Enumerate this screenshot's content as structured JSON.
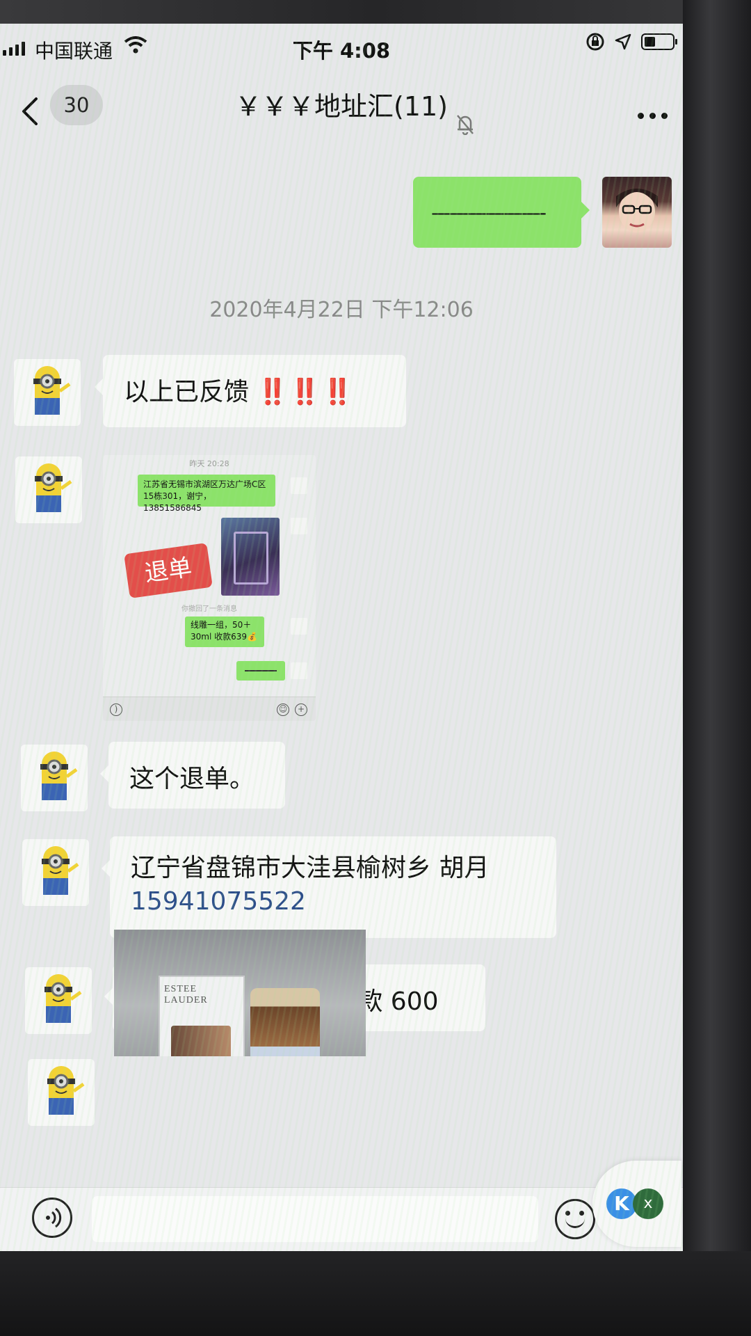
{
  "status_bar": {
    "carrier": "中国联通",
    "time": "下午 4:08"
  },
  "nav": {
    "unread_count": "30",
    "title": "￥￥￥地址汇(11)"
  },
  "colors": {
    "my_bubble": "#8ce26a",
    "their_bubble": "#f7f7f7",
    "alert_red": "#d92a2a",
    "phone_link": "#2d4e8a",
    "stamp_red": "#e34e4a"
  },
  "messages": {
    "m1_text": "——————-",
    "timestamp": "2020年4月22日 下午12:06",
    "m2_text": "以上已反馈",
    "m2_marks": "‼️‼️‼️",
    "m3_embed": {
      "time": "昨天 20:28",
      "addr_bubble": "江苏省无锡市滨湖区万达广场C区15栋301，谢宁，13851586845",
      "stamp": "退单",
      "recall_note": "你撤回了一条消息",
      "order_bubble": "线雕一组，50＋30ml 收款639💰"
    },
    "m4_text": "这个退单。",
    "m5_address": "辽宁省盘锦市大洼县榆树乡 胡月",
    "m5_phone": "15941075522",
    "m6_text": "抗蓝光眼霜 2瓶，收款 600",
    "m7_photo_brand": "ESTEE LAUDER"
  },
  "float_widget": {
    "k_label": "K",
    "close_label": "x"
  }
}
